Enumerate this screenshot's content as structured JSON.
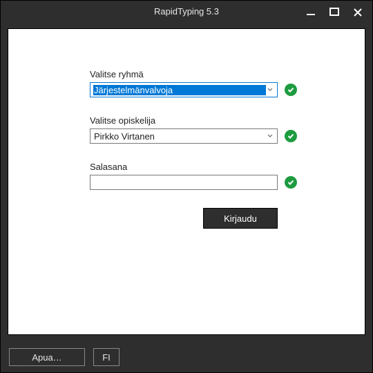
{
  "window": {
    "title": "RapidTyping 5.3"
  },
  "form": {
    "group": {
      "label": "Valitse ryhmä",
      "value": "Järjestelmänvalvoja"
    },
    "student": {
      "label": "Valitse opiskelija",
      "value": "Pirkko Virtanen"
    },
    "password": {
      "label": "Salasana",
      "value": ""
    },
    "submit": "Kirjaudu"
  },
  "footer": {
    "help": "Apua…",
    "lang": "FI"
  },
  "colors": {
    "accent": "#0078d7",
    "success": "#1d9c3f",
    "chrome": "#2e2e2e"
  }
}
